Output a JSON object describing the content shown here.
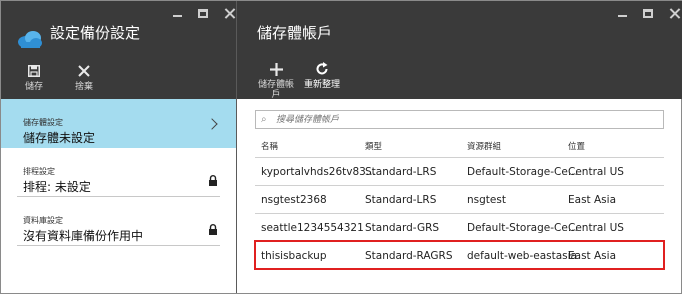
{
  "left_blade": {
    "title": "設定備份設定",
    "commands": [
      {
        "label": "儲存",
        "icon": "save-icon"
      },
      {
        "label": "捨棄",
        "icon": "discard-icon"
      }
    ],
    "settings": [
      {
        "label": "儲存體設定",
        "value": "儲存體未設定",
        "selected": true,
        "indicator": "chevron-right-icon"
      },
      {
        "label": "排程設定",
        "value": "排程: 未設定",
        "selected": false,
        "indicator": "lock-icon"
      },
      {
        "label": "資料庫設定",
        "value": "沒有資料庫備份作用中",
        "selected": false,
        "indicator": "lock-icon"
      }
    ]
  },
  "right_blade": {
    "title": "儲存體帳戶",
    "commands": [
      {
        "label": "儲存體帳\n戶",
        "icon": "add-icon"
      },
      {
        "label": "重新整理",
        "icon": "refresh-icon"
      }
    ],
    "search": {
      "placeholder": "搜尋儲存體帳戶",
      "value": ""
    },
    "columns": [
      "名稱",
      "類型",
      "資源群組",
      "位置"
    ],
    "rows": [
      [
        "kyportalvhds26tv83...",
        "Standard-LRS",
        "Default-Storage-Ce...",
        "Central US"
      ],
      [
        "nsgtest2368",
        "Standard-LRS",
        "nsgtest",
        "East Asia"
      ],
      [
        "seattle1234554321",
        "Standard-GRS",
        "Default-Storage-Ce...",
        "Central US"
      ],
      [
        "thisisbackup",
        "Standard-RAGRS",
        "default-web-eastasia",
        "East Asia"
      ]
    ],
    "highlighted_row": 3
  },
  "colors": {
    "header_bg": "#3a3a3a",
    "selected_item_bg": "#a4dcef",
    "highlight_border": "#e02020",
    "cloud_icon": "#2f8fd4"
  }
}
